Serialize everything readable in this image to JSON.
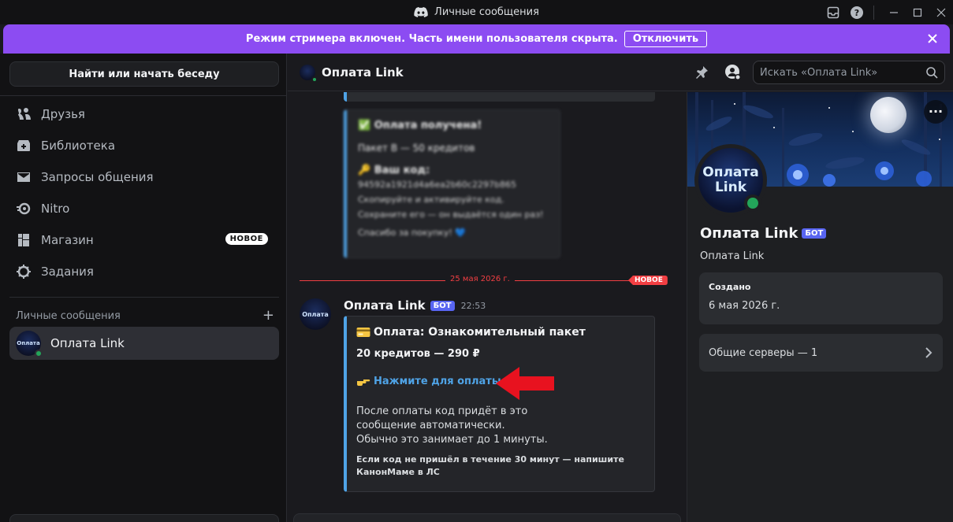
{
  "window": {
    "title": "Личные сообщения"
  },
  "banner": {
    "text": "Режим стримера включен. Часть имени пользователя скрыта.",
    "button_label": "Отключить",
    "color": "#8c4cf2"
  },
  "sidebar": {
    "search_label": "Найти или начать беседу",
    "nav": [
      {
        "label": "Друзья",
        "icon": "friends-icon"
      },
      {
        "label": "Библиотека",
        "icon": "library-icon"
      },
      {
        "label": "Запросы общения",
        "icon": "mail-icon"
      },
      {
        "label": "Nitro",
        "icon": "nitro-icon"
      },
      {
        "label": "Магазин",
        "icon": "shop-icon",
        "badge": "НОВОЕ"
      },
      {
        "label": "Задания",
        "icon": "quests-icon"
      }
    ],
    "dm_header": "Личные сообщения",
    "dm_add": "+",
    "dms": [
      {
        "name": "Оплата Link",
        "status": "online"
      }
    ]
  },
  "chat": {
    "title": "Оплата Link",
    "search_placeholder": "Искать «Оплата Link»",
    "blurred_embed": {
      "line1": "✅ Оплата получена!",
      "line2": "Пакет B — 50 кредитов",
      "line3": "🔑 Ваш код:",
      "line4": "94592a1921d4a6ea2b60c2297b865",
      "line5": "Скопируйте и активируйте код.",
      "line6": "Сохраните его — он выдаётся один раз!",
      "line7": "Спасибо за покупку! 💙"
    },
    "date_divider": "25 мая 2026 г.",
    "new_flag": "НОВОЕ",
    "message": {
      "author": "Оплата Link",
      "tag": "БОТ",
      "time": "22:53",
      "embed": {
        "title": "Оплата: Ознакомительный пакет",
        "amount": "20 кредитов — 290 ₽",
        "link": "Нажмите для оплаты",
        "text1": "После оплаты код придёт в это сообщение автоматически.",
        "text2": "Обычно это занимает до 1 минуты.",
        "footer": "Если код не пришёл в течение 30 минут — напишите КанонМаме в ЛС"
      }
    }
  },
  "profile": {
    "avatar_text_1": "Оплата",
    "avatar_text_2": "Link",
    "name": "Оплата Link",
    "tag": "БОТ",
    "username": "Оплата Link",
    "created_label": "Создано",
    "created_value": "6 мая 2026 г.",
    "mutual_servers": "Общие серверы — 1"
  },
  "colors": {
    "online": "#23a55a",
    "accent_link": "#4fa3e6",
    "bot_tag": "#5865f2",
    "new_red": "#f23f43"
  }
}
